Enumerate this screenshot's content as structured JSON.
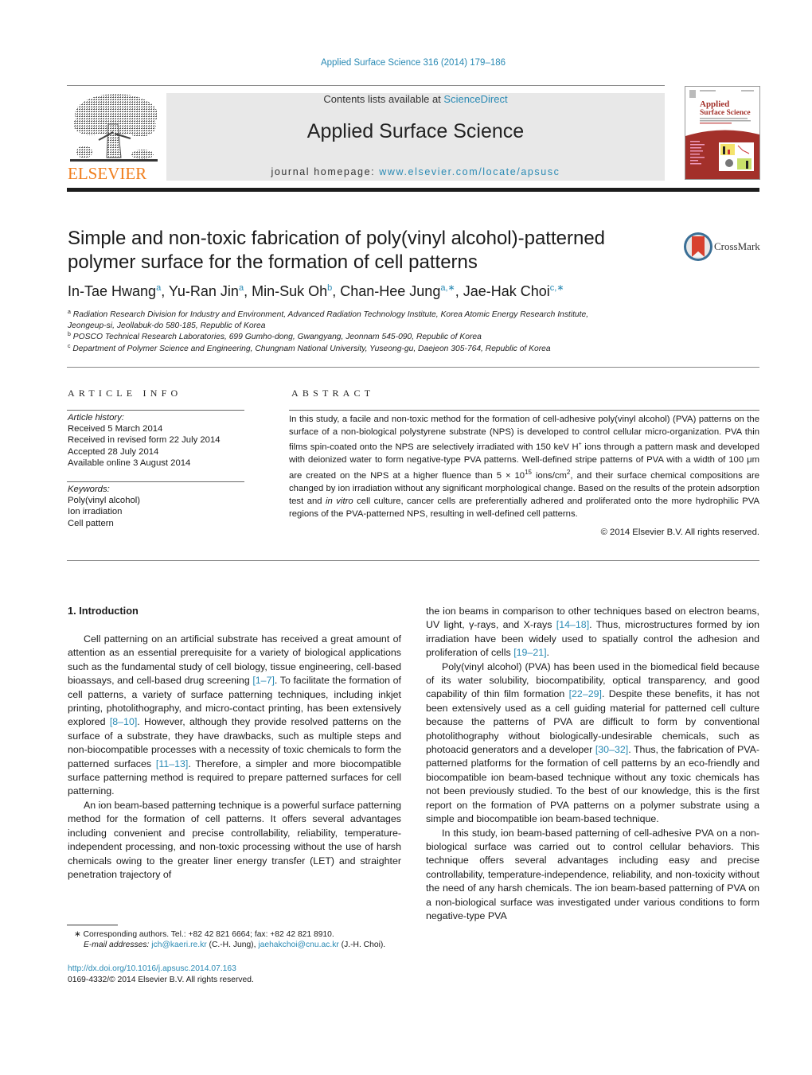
{
  "citation": "Applied Surface Science 316 (2014) 179–186",
  "header": {
    "contents_prefix": "Contents lists available at ",
    "contents_link": "ScienceDirect",
    "journal_name": "Applied Surface Science",
    "homepage_prefix": "journal homepage: ",
    "homepage_link": "www.elsevier.com/locate/apsusc",
    "publisher_wordmark": "ELSEVIER",
    "cover_title_line1": "Applied",
    "cover_title_line2": "Surface Science",
    "brand_orange": "#f07e1c",
    "link_blue": "#2a8ab4",
    "cover_red": "#a3302a"
  },
  "title": {
    "line1": "Simple and non-toxic fabrication of poly(vinyl alcohol)-patterned",
    "line2": "polymer surface for the formation of cell patterns",
    "crossmark_label": "CrossMark"
  },
  "authors": [
    {
      "name": "In-Tae Hwang",
      "sup": "a"
    },
    {
      "name": "Yu-Ran Jin",
      "sup": "a"
    },
    {
      "name": "Min-Suk Oh",
      "sup": "b"
    },
    {
      "name": "Chan-Hee Jung",
      "sup": "a,∗"
    },
    {
      "name": "Jae-Hak Choi",
      "sup": "c,∗"
    }
  ],
  "affiliations": [
    {
      "mark": "a",
      "line1": "Radiation Research Division for Industry and Environment, Advanced Radiation Technology Institute, Korea Atomic Energy Research Institute,",
      "line2": "Jeongeup-si, Jeollabuk-do 580-185, Republic of Korea"
    },
    {
      "mark": "b",
      "line1": "POSCO Technical Research Laboratories, 699 Gumho-dong, Gwangyang, Jeonnam 545-090, Republic of Korea"
    },
    {
      "mark": "c",
      "line1": "Department of Polymer Science and Engineering, Chungnam National University, Yuseong-gu, Daejeon 305-764, Republic of Korea"
    }
  ],
  "article_info": {
    "heading": "ARTICLE INFO",
    "history_label": "Article history:",
    "history": [
      "Received 5 March 2014",
      "Received in revised form 22 July 2014",
      "Accepted 28 July 2014",
      "Available online 3 August 2014"
    ],
    "keywords_label": "Keywords:",
    "keywords": [
      "Poly(vinyl alcohol)",
      "Ion irradiation",
      "Cell pattern"
    ]
  },
  "abstract": {
    "heading": "ABSTRACT",
    "part1": "In this study, a facile and non-toxic method for the formation of cell-adhesive poly(vinyl alcohol) (PVA) patterns on the surface of a non-biological polystyrene substrate (NPS) is developed to control cellular micro-organization. PVA thin films spin-coated onto the NPS are selectively irradiated with 150 keV H",
    "sup_plus": "+",
    "part2": " ions through a pattern mask and developed with deionized water to form negative-type PVA patterns. Well-defined stripe patterns of PVA with a width of 100 μm are created on the NPS at a higher fluence than 5 × 10",
    "sup_15": "15",
    "part3": " ions/cm",
    "sup_2": "2",
    "part4": ", and their surface chemical compositions are changed by ion irradiation without any significant morphological change. Based on the results of the protein adsorption test and ",
    "italic": "in vitro",
    "part5": " cell culture, cancer cells are preferentially adhered and proliferated onto the more hydrophilic PVA regions of the PVA-patterned NPS, resulting in well-defined cell patterns.",
    "copyright": "© 2014 Elsevier B.V. All rights reserved."
  },
  "body": {
    "section_heading": "1.  Introduction",
    "left": {
      "p1_a": "Cell patterning on an artificial substrate has received a great amount of attention as an essential prerequisite for a variety of biological applications such as the fundamental study of cell biology, tissue engineering, cell-based bioassays, and cell-based drug screening ",
      "p1_ref1": "[1–7]",
      "p1_b": ". To facilitate the formation of cell patterns, a variety of surface patterning techniques, including inkjet printing, photolithography, and micro-contact printing, has been extensively explored ",
      "p1_ref2": "[8–10]",
      "p1_c": ". However, although they provide resolved patterns on the surface of a substrate, they have drawbacks, such as multiple steps and non-biocompatible processes with a necessity of toxic chemicals to form the patterned surfaces ",
      "p1_ref3": "[11–13]",
      "p1_d": ". Therefore, a simpler and more biocompatible surface patterning method is required to prepare patterned surfaces for cell patterning.",
      "p2": "An ion beam-based patterning technique is a powerful surface patterning method for the formation of cell patterns. It offers several advantages including convenient and precise controllability, reliability, temperature-independent processing, and non-toxic processing without the use of harsh chemicals owing to the greater liner energy transfer (LET) and straighter penetration trajectory of"
    },
    "right": {
      "p0_a": "the ion beams in comparison to other techniques based on electron beams, UV light, γ-rays, and X-rays ",
      "p0_ref1": "[14–18]",
      "p0_b": ". Thus, microstructures formed by ion irradiation have been widely used to spatially control the adhesion and proliferation of cells ",
      "p0_ref2": "[19–21]",
      "p0_c": ".",
      "p1_a": "Poly(vinyl alcohol) (PVA) has been used in the biomedical field because of its water solubility, biocompatibility, optical transparency, and good capability of thin film formation ",
      "p1_ref1": "[22–29]",
      "p1_b": ". Despite these benefits, it has not been extensively used as a cell guiding material for patterned cell culture because the patterns of PVA are difficult to form by conventional photolithography without biologically-undesirable chemicals, such as photoacid generators and a developer ",
      "p1_ref2": "[30–32]",
      "p1_c": ". Thus, the fabrication of PVA-patterned platforms for the formation of cell patterns by an eco-friendly and biocompatible ion beam-based technique without any toxic chemicals has not been previously studied. To the best of our knowledge, this is the first report on the formation of PVA patterns on a polymer substrate using a simple and biocompatible ion beam-based technique.",
      "p2": "In this study, ion beam-based patterning of cell-adhesive PVA on a non-biological surface was carried out to control cellular behaviors. This technique offers several advantages including easy and precise controllability, temperature-independence, reliability, and non-toxicity without the need of any harsh chemicals. The ion beam-based patterning of PVA on a non-biological surface was investigated under various conditions to form negative-type PVA"
    }
  },
  "footnotes": {
    "star": "∗",
    "corresponding": " Corresponding authors. Tel.: +82 42 821 6664; fax: +82 42 821 8910.",
    "email_label": "E-mail addresses:",
    "email1": "jch@kaeri.re.kr",
    "email1_name": " (C.-H. Jung), ",
    "email2": "jaehakchoi@cnu.ac.kr",
    "email2_name": " (J.-H. Choi).",
    "doi": "http://dx.doi.org/10.1016/j.apsusc.2014.07.163",
    "issn": "0169-4332/© 2014 Elsevier B.V. All rights reserved."
  }
}
